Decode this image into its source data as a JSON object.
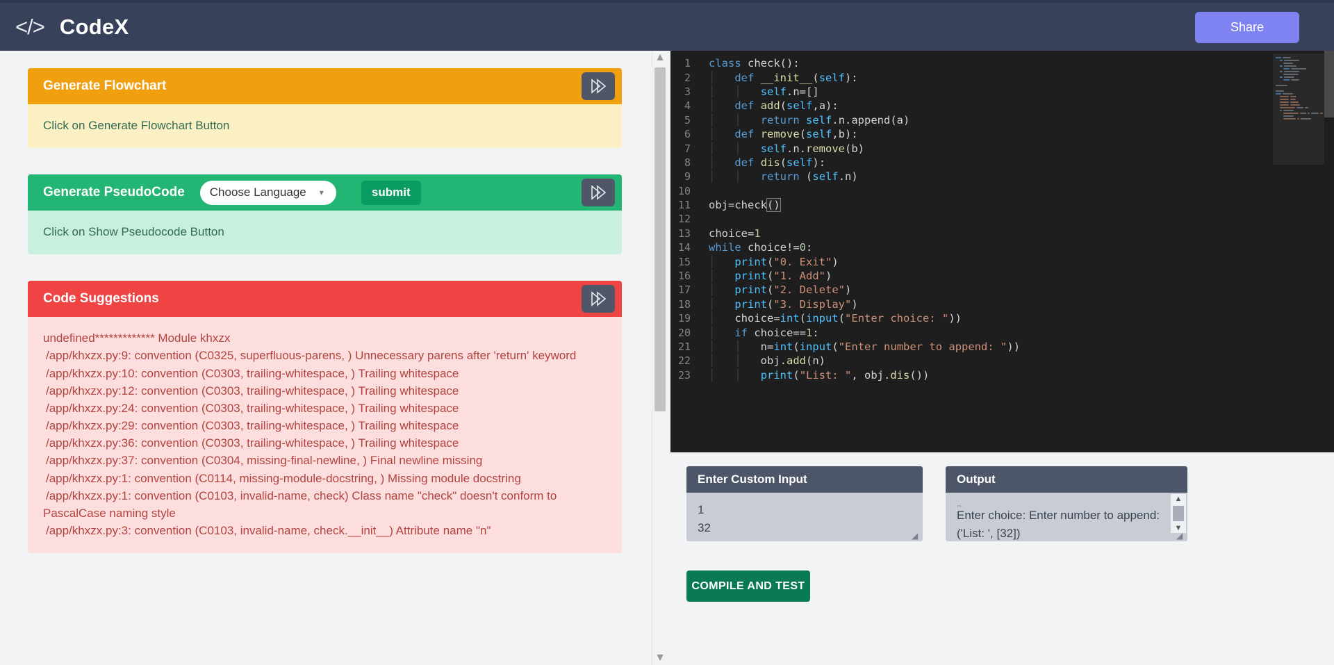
{
  "header": {
    "brand_icon": "code-tags-icon",
    "brand_name": "CodeX",
    "share_label": "Share"
  },
  "panels": {
    "flowchart": {
      "title": "Generate Flowchart",
      "body_text": "Click on Generate Flowchart Button",
      "header_color": "#f0a00f",
      "body_color": "#fbf0c4",
      "toggle_icon": "double-chevron-right-icon"
    },
    "pseudocode": {
      "title": "Generate PseudoCode",
      "select_value": "Choose Language",
      "submit_label": "submit",
      "body_text": "Click on Show Pseudocode Button",
      "header_color": "#22b573",
      "body_color": "#c9f0de",
      "toggle_icon": "double-chevron-right-icon"
    },
    "suggestions": {
      "title": "Code Suggestions",
      "header_color": "#ef4444",
      "body_color": "#fbdedd",
      "toggle_icon": "double-chevron-right-icon",
      "lines": [
        "undefined************* Module khxzx",
        "/app/khxzx.py:9: convention (C0325, superfluous-parens, ) Unnecessary parens after 'return' keyword",
        "/app/khxzx.py:10: convention (C0303, trailing-whitespace, ) Trailing whitespace",
        "/app/khxzx.py:12: convention (C0303, trailing-whitespace, ) Trailing whitespace",
        "/app/khxzx.py:24: convention (C0303, trailing-whitespace, ) Trailing whitespace",
        "/app/khxzx.py:29: convention (C0303, trailing-whitespace, ) Trailing whitespace",
        "/app/khxzx.py:36: convention (C0303, trailing-whitespace, ) Trailing whitespace",
        "/app/khxzx.py:37: convention (C0304, missing-final-newline, ) Final newline missing",
        "/app/khxzx.py:1: convention (C0114, missing-module-docstring, ) Missing module docstring",
        "/app/khxzx.py:1: convention (C0103, invalid-name, check) Class name \"check\" doesn't conform to PascalCase naming style",
        "/app/khxzx.py:3: convention (C0103, invalid-name, check.__init__) Attribute name \"n\""
      ]
    }
  },
  "editor": {
    "language": "python",
    "cursor_line": 11,
    "lines": [
      {
        "n": "1",
        "text": "class check():"
      },
      {
        "n": "2",
        "text": "    def __init__(self):"
      },
      {
        "n": "3",
        "text": "        self.n=[]"
      },
      {
        "n": "4",
        "text": "    def add(self,a):"
      },
      {
        "n": "5",
        "text": "        return self.n.append(a)"
      },
      {
        "n": "6",
        "text": "    def remove(self,b):"
      },
      {
        "n": "7",
        "text": "        self.n.remove(b)"
      },
      {
        "n": "8",
        "text": "    def dis(self):"
      },
      {
        "n": "9",
        "text": "        return (self.n)"
      },
      {
        "n": "10",
        "text": ""
      },
      {
        "n": "11",
        "text": "obj=check()"
      },
      {
        "n": "12",
        "text": ""
      },
      {
        "n": "13",
        "text": "choice=1"
      },
      {
        "n": "14",
        "text": "while choice!=0:"
      },
      {
        "n": "15",
        "text": "    print(\"0. Exit\")"
      },
      {
        "n": "16",
        "text": "    print(\"1. Add\")"
      },
      {
        "n": "17",
        "text": "    print(\"2. Delete\")"
      },
      {
        "n": "18",
        "text": "    print(\"3. Display\")"
      },
      {
        "n": "19",
        "text": "    choice=int(input(\"Enter choice: \"))"
      },
      {
        "n": "20",
        "text": "    if choice==1:"
      },
      {
        "n": "21",
        "text": "        n=int(input(\"Enter number to append: \"))"
      },
      {
        "n": "22",
        "text": "        obj.add(n)"
      },
      {
        "n": "23",
        "text": "        print(\"List: \", obj.dis())"
      }
    ]
  },
  "io": {
    "input": {
      "title": "Enter Custom Input",
      "value_line1": "1",
      "value_line2": "32"
    },
    "output": {
      "title": "Output",
      "clipped_line": "')",
      "line1": "Enter choice: Enter number to append:",
      "line2": "('List: ', [32])",
      "line3": "()"
    },
    "compile_label": "COMPILE AND TEST"
  }
}
